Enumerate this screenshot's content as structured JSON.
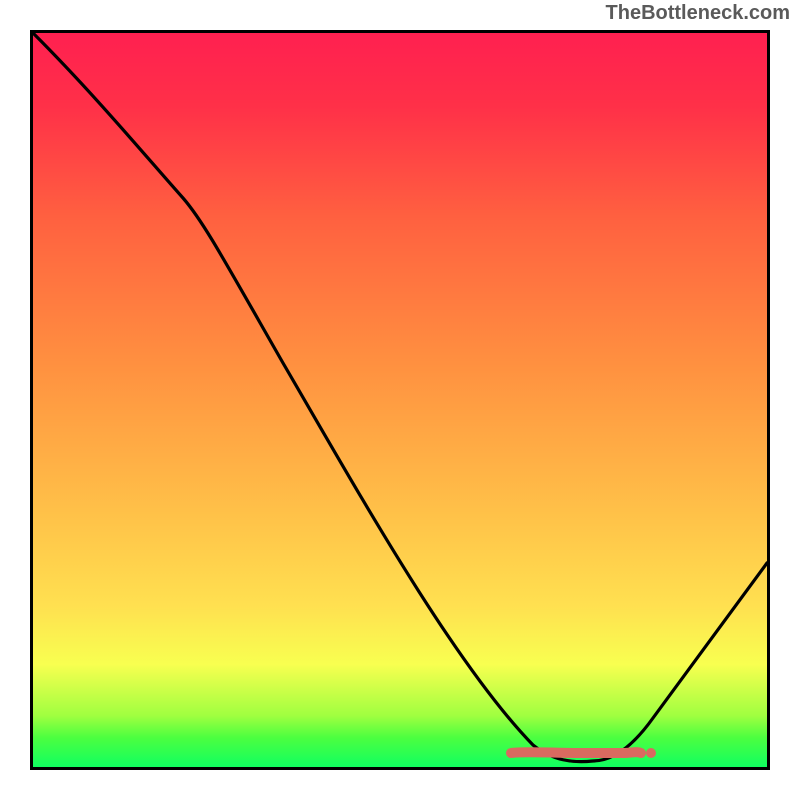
{
  "watermark": "TheBottleneck.com",
  "chart_data": {
    "type": "line",
    "title": "",
    "xlabel": "",
    "ylabel": "",
    "xlim": [
      0,
      100
    ],
    "ylim": [
      0,
      100
    ],
    "grid": false,
    "legend": false,
    "series": [
      {
        "name": "curve",
        "x": [
          0,
          20,
          72,
          80,
          100
        ],
        "y": [
          100,
          78,
          1,
          1,
          28
        ]
      },
      {
        "name": "marker-band",
        "x": [
          66,
          82
        ],
        "y": [
          1.5,
          1.5
        ]
      }
    ],
    "gradient_stops": [
      {
        "pos": 0,
        "color": "#10ff60"
      },
      {
        "pos": 4,
        "color": "#4cff40"
      },
      {
        "pos": 7,
        "color": "#a0ff40"
      },
      {
        "pos": 14,
        "color": "#f8ff50"
      },
      {
        "pos": 22,
        "color": "#ffe050"
      },
      {
        "pos": 35,
        "color": "#ffc048"
      },
      {
        "pos": 55,
        "color": "#ff9040"
      },
      {
        "pos": 75,
        "color": "#ff6040"
      },
      {
        "pos": 90,
        "color": "#ff3048"
      },
      {
        "pos": 100,
        "color": "#ff2050"
      }
    ]
  }
}
